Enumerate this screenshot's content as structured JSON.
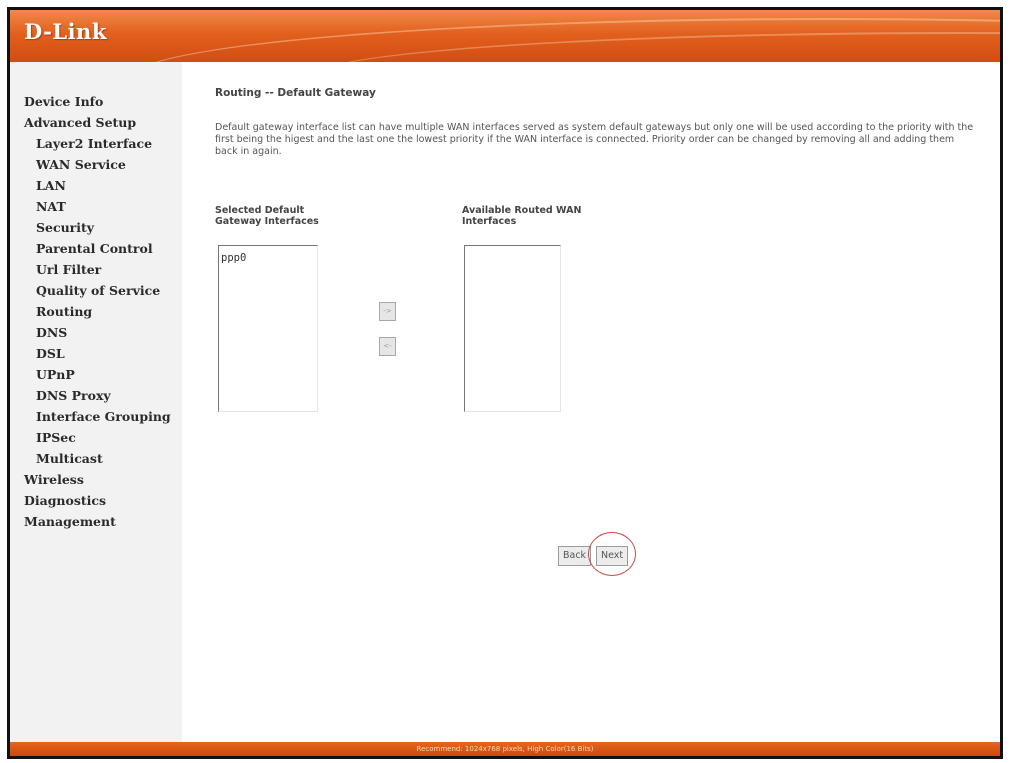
{
  "brand": {
    "logo": "D-Link"
  },
  "sidebar": {
    "items": [
      {
        "label": "Device Info",
        "level": 0
      },
      {
        "label": "Advanced Setup",
        "level": 0
      },
      {
        "label": "Layer2 Interface",
        "level": 1
      },
      {
        "label": "WAN Service",
        "level": 1
      },
      {
        "label": "LAN",
        "level": 1
      },
      {
        "label": "NAT",
        "level": 1
      },
      {
        "label": "Security",
        "level": 1
      },
      {
        "label": "Parental Control",
        "level": 1
      },
      {
        "label": "Url Filter",
        "level": 1
      },
      {
        "label": "Quality of Service",
        "level": 1
      },
      {
        "label": "Routing",
        "level": 1
      },
      {
        "label": "DNS",
        "level": 1
      },
      {
        "label": "DSL",
        "level": 1
      },
      {
        "label": "UPnP",
        "level": 1
      },
      {
        "label": "DNS Proxy",
        "level": 1
      },
      {
        "label": "Interface Grouping",
        "level": 1
      },
      {
        "label": "IPSec",
        "level": 1
      },
      {
        "label": "Multicast",
        "level": 1
      },
      {
        "label": "Wireless",
        "level": 0
      },
      {
        "label": "Diagnostics",
        "level": 0
      },
      {
        "label": "Management",
        "level": 0
      }
    ]
  },
  "main": {
    "title": "Routing -- Default Gateway",
    "description": "Default gateway interface list can have multiple WAN interfaces served as system default gateways but only one will be used according to the priority with the first being the higest and the last one the lowest priority if the WAN interface is connected. Priority order can be changed by removing all and adding them back in again.",
    "selected_label_line1": "Selected Default",
    "selected_label_line2": "Gateway Interfaces",
    "available_label_line1": "Available Routed WAN",
    "available_label_line2": "Interfaces",
    "selected_interfaces": [
      "ppp0"
    ],
    "available_interfaces": [],
    "add_button": "->",
    "remove_button": "<-",
    "back_button": "Back",
    "next_button": "Next"
  },
  "footer": {
    "text": "Recommend: 1024x768 pixels, High Color(16 Bits)"
  },
  "colors": {
    "header": "#e2601e",
    "sidebar_bg": "#f2f2f2",
    "footer": "#c94a0e",
    "highlight": "#c94a4a"
  }
}
